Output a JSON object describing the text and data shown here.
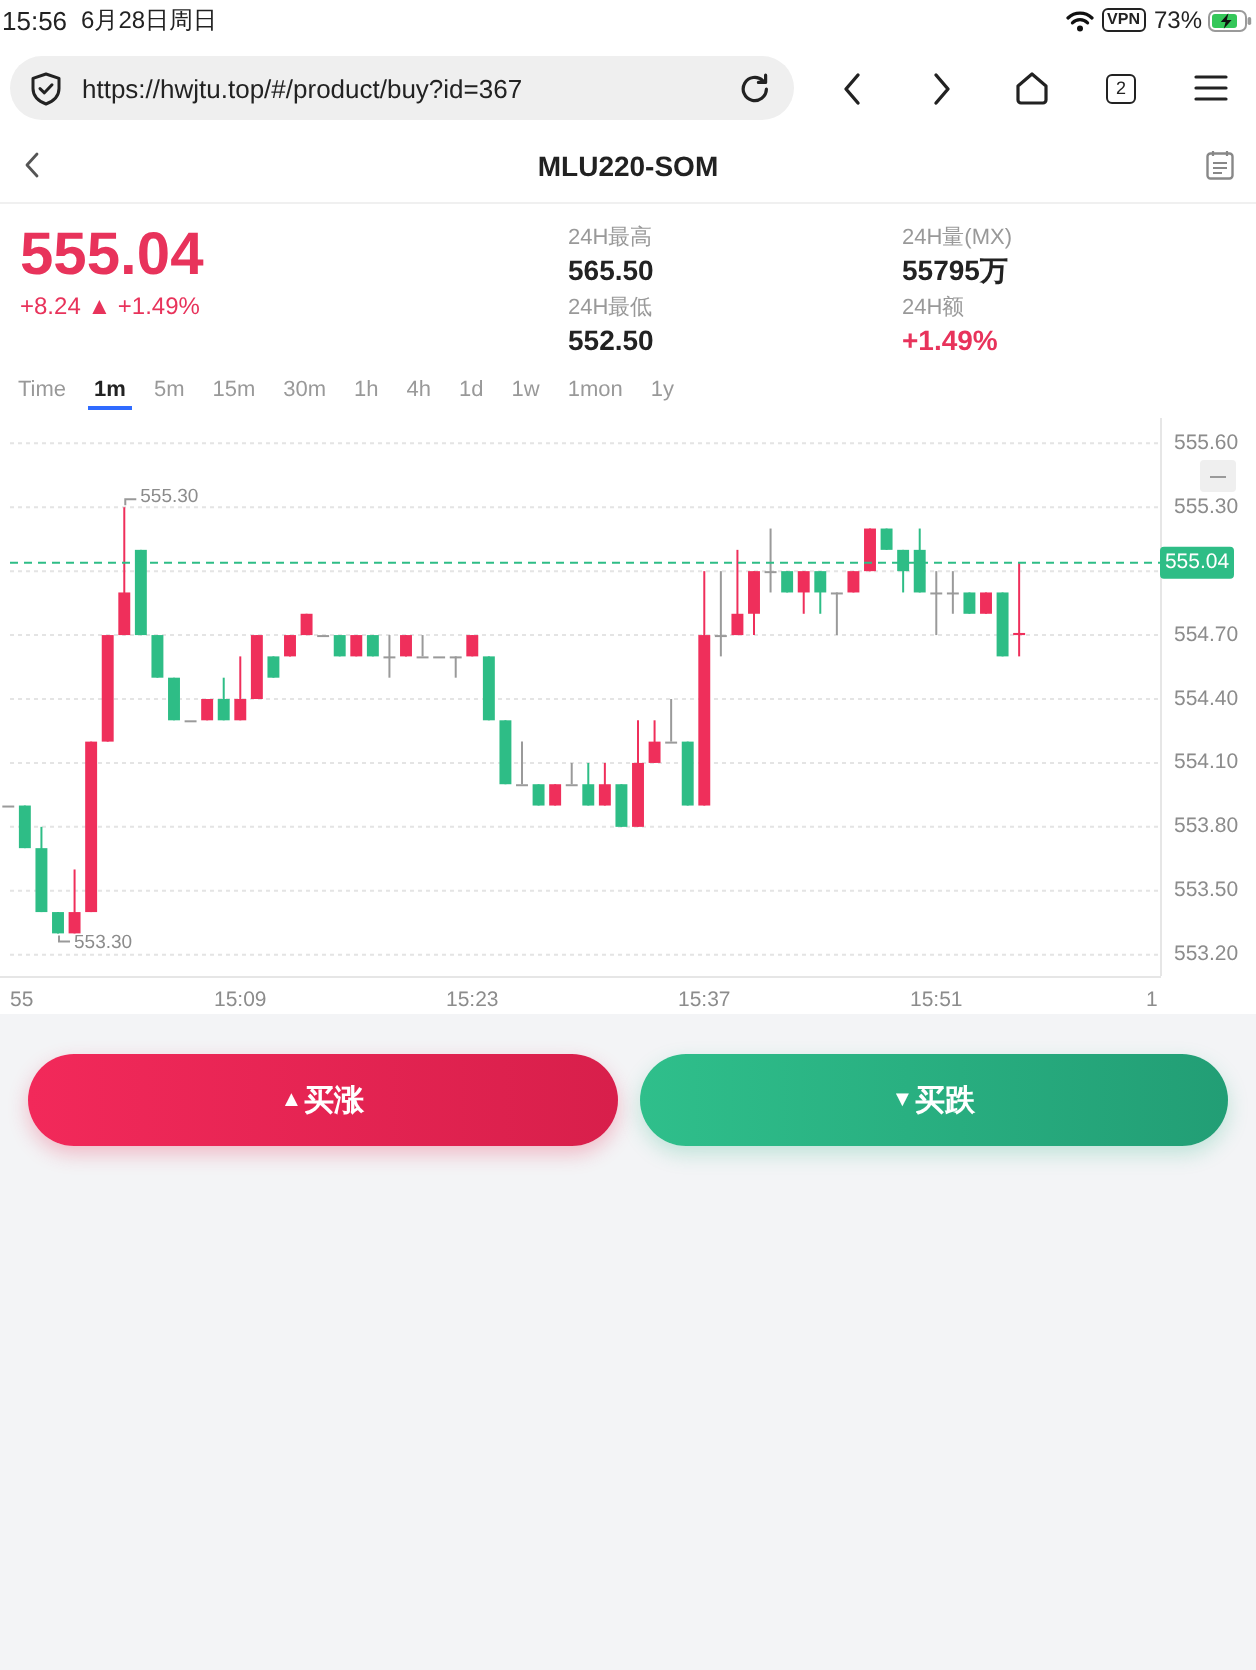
{
  "status_bar": {
    "time": "15:56",
    "date": "6月28日周日",
    "vpn": "VPN",
    "battery": "73%"
  },
  "browser": {
    "url": "https://hwjtu.top/#/product/buy?id=367",
    "tab_count": "2"
  },
  "header": {
    "title": "MLU220-SOM"
  },
  "quote": {
    "rising": true,
    "price": "555.04",
    "change": "+8.24 ▲ +1.49%",
    "stats": [
      {
        "label": "24H最高",
        "value": "565.50",
        "kind": "plain"
      },
      {
        "label": "24H量(MX)",
        "value": "55795万",
        "kind": "plain"
      },
      {
        "label": "24H最低",
        "value": "552.50",
        "kind": "plain"
      },
      {
        "label": "24H额",
        "value": "+1.49%",
        "kind": "change"
      }
    ]
  },
  "intervals": [
    {
      "label": "Time",
      "selected": false
    },
    {
      "label": "1m",
      "selected": true
    },
    {
      "label": "5m",
      "selected": false
    },
    {
      "label": "15m",
      "selected": false
    },
    {
      "label": "30m",
      "selected": false
    },
    {
      "label": "1h",
      "selected": false
    },
    {
      "label": "4h",
      "selected": false
    },
    {
      "label": "1d",
      "selected": false
    },
    {
      "label": "1w",
      "selected": false
    },
    {
      "label": "1mon",
      "selected": false
    },
    {
      "label": "1y",
      "selected": false
    }
  ],
  "chart": {
    "chart_data": {
      "type": "candlestick",
      "x": [
        895,
        896,
        897,
        898,
        899,
        900,
        901,
        902,
        903,
        904,
        905,
        906,
        907,
        908,
        909,
        910,
        911,
        912,
        913,
        914,
        915,
        916,
        917,
        918,
        919,
        920,
        921,
        922,
        923,
        924,
        925,
        926,
        927,
        928,
        929,
        930,
        931,
        932,
        933,
        934,
        935,
        936,
        937,
        938,
        939,
        940,
        941,
        942,
        943,
        944,
        945,
        946,
        947,
        948,
        949,
        950,
        951,
        952,
        953,
        954,
        955,
        956
      ],
      "ohlc": [
        [
          553.9,
          553.9,
          553.9,
          553.9
        ],
        [
          553.9,
          553.9,
          553.7,
          553.7
        ],
        [
          553.7,
          553.8,
          553.4,
          553.4
        ],
        [
          553.4,
          553.4,
          553.3,
          553.3
        ],
        [
          553.3,
          553.6,
          553.3,
          553.4
        ],
        [
          553.4,
          554.2,
          553.4,
          554.2
        ],
        [
          554.2,
          554.7,
          554.2,
          554.7
        ],
        [
          554.7,
          555.3,
          554.7,
          554.9
        ],
        [
          555.1,
          555.1,
          554.7,
          554.7
        ],
        [
          554.7,
          554.7,
          554.5,
          554.5
        ],
        [
          554.5,
          554.5,
          554.3,
          554.3
        ],
        [
          554.3,
          554.3,
          554.3,
          554.3
        ],
        [
          554.3,
          554.4,
          554.3,
          554.4
        ],
        [
          554.4,
          554.5,
          554.3,
          554.3
        ],
        [
          554.3,
          554.6,
          554.3,
          554.4
        ],
        [
          554.4,
          554.7,
          554.4,
          554.7
        ],
        [
          554.6,
          554.6,
          554.5,
          554.5
        ],
        [
          554.6,
          554.7,
          554.6,
          554.7
        ],
        [
          554.7,
          554.8,
          554.7,
          554.8
        ],
        [
          554.7,
          554.7,
          554.7,
          554.7
        ],
        [
          554.7,
          554.7,
          554.6,
          554.6
        ],
        [
          554.6,
          554.7,
          554.6,
          554.7
        ],
        [
          554.7,
          554.7,
          554.6,
          554.6
        ],
        [
          554.6,
          554.7,
          554.5,
          554.6
        ],
        [
          554.6,
          554.7,
          554.6,
          554.7
        ],
        [
          554.6,
          554.7,
          554.6,
          554.6
        ],
        [
          554.6,
          554.6,
          554.6,
          554.6
        ],
        [
          554.6,
          554.6,
          554.5,
          554.6
        ],
        [
          554.6,
          554.7,
          554.6,
          554.7
        ],
        [
          554.6,
          554.6,
          554.3,
          554.3
        ],
        [
          554.3,
          554.3,
          554.0,
          554.0
        ],
        [
          554.0,
          554.2,
          554.0,
          554.0
        ],
        [
          554.0,
          554.0,
          553.9,
          553.9
        ],
        [
          553.9,
          554.0,
          553.9,
          554.0
        ],
        [
          554.0,
          554.1,
          554.0,
          554.0
        ],
        [
          554.0,
          554.1,
          553.9,
          553.9
        ],
        [
          553.9,
          554.1,
          553.9,
          554.0
        ],
        [
          554.0,
          554.0,
          553.8,
          553.8
        ],
        [
          553.8,
          554.3,
          553.8,
          554.1
        ],
        [
          554.1,
          554.3,
          554.1,
          554.2
        ],
        [
          554.2,
          554.4,
          554.2,
          554.2
        ],
        [
          554.2,
          554.2,
          553.9,
          553.9
        ],
        [
          553.9,
          555.0,
          553.9,
          554.7
        ],
        [
          554.7,
          555.0,
          554.6,
          554.7
        ],
        [
          554.7,
          555.1,
          554.7,
          554.8
        ],
        [
          554.8,
          555.0,
          554.7,
          555.0
        ],
        [
          555.0,
          555.2,
          554.9,
          555.0
        ],
        [
          555.0,
          555.0,
          554.9,
          554.9
        ],
        [
          554.9,
          555.0,
          554.8,
          555.0
        ],
        [
          555.0,
          555.0,
          554.8,
          554.9
        ],
        [
          554.9,
          554.9,
          554.7,
          554.9
        ],
        [
          554.9,
          555.0,
          554.9,
          555.0
        ],
        [
          555.0,
          555.2,
          555.0,
          555.2
        ],
        [
          555.2,
          555.2,
          555.1,
          555.1
        ],
        [
          555.1,
          555.1,
          554.9,
          555.0
        ],
        [
          555.1,
          555.2,
          554.9,
          554.9
        ],
        [
          554.9,
          555.0,
          554.7,
          554.9
        ],
        [
          554.9,
          555.0,
          554.8,
          554.9
        ],
        [
          554.9,
          554.9,
          554.8,
          554.8
        ],
        [
          554.8,
          554.9,
          554.8,
          554.9
        ],
        [
          554.9,
          554.9,
          554.6,
          554.6
        ],
        [
          554.7,
          555.04,
          554.6,
          554.71
        ]
      ],
      "xlim": [
        894.5,
        964.5
      ],
      "ylim": [
        553.1,
        555.7
      ],
      "xticks": [
        {
          "value": 909,
          "label": "15:09"
        },
        {
          "value": 923,
          "label": "15:23"
        },
        {
          "value": 937,
          "label": "15:37"
        },
        {
          "value": 951,
          "label": "15:51"
        }
      ],
      "yticks": [
        {
          "value": 555.6,
          "label": "555.60"
        },
        {
          "value": 555.3,
          "label": "555.30"
        },
        {
          "value": 554.7,
          "label": "554.70"
        },
        {
          "value": 554.4,
          "label": "554.40"
        },
        {
          "value": 554.1,
          "label": "554.10"
        },
        {
          "value": 553.8,
          "label": "553.80"
        },
        {
          "value": 553.5,
          "label": "553.50"
        },
        {
          "value": 553.2,
          "label": "553.20"
        }
      ],
      "grid": true,
      "annotations": [
        "555.30",
        "553.30"
      ],
      "ref_lines": [
        {
          "axis": "y",
          "value": 555.04,
          "label": "555.04"
        }
      ]
    },
    "clipped_time_labels": [
      "55",
      "1"
    ]
  },
  "actions": [
    {
      "kind": "up",
      "mark": "▲",
      "label": "买涨"
    },
    {
      "kind": "down",
      "mark": "▼",
      "label": "买跌"
    }
  ]
}
